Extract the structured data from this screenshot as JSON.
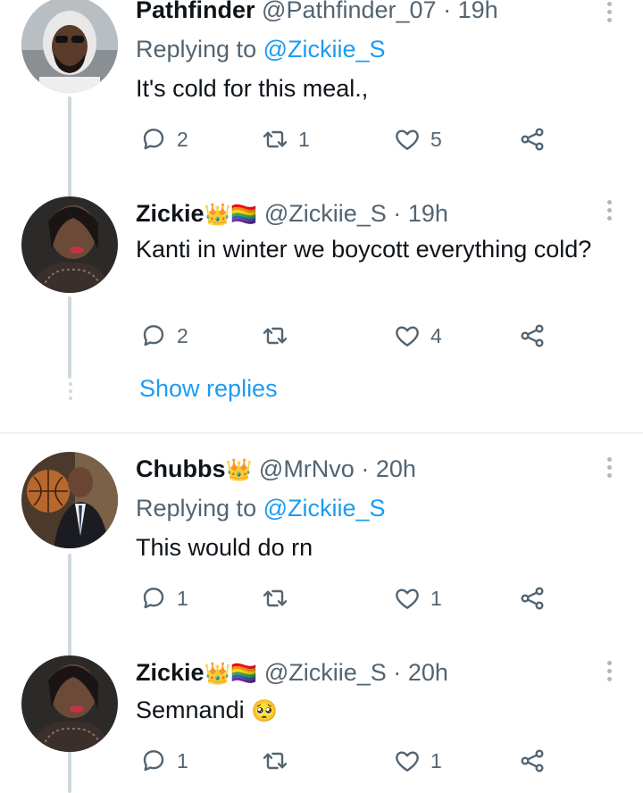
{
  "tweets": [
    {
      "name": "Pathfinder",
      "name_suffix": "",
      "handle": "@Pathfinder_07",
      "dot": "·",
      "time": "19h",
      "replying_prefix": "Replying to ",
      "replying_to": "@Zickiie_S",
      "text": "It's cold for this meal.,",
      "replies": "2",
      "retweets": "1",
      "likes": "5"
    },
    {
      "name": "Zickie",
      "name_suffix": "👑🏳️‍🌈",
      "handle": "@Zickiie_S",
      "dot": "·",
      "time": "19h",
      "text": "Kanti in winter we boycott everything cold?",
      "replies": "2",
      "retweets": "",
      "likes": "4"
    },
    {
      "name": "Chubbs",
      "name_suffix": "👑",
      "handle": "@MrNvo",
      "dot": "·",
      "time": "20h",
      "replying_prefix": "Replying to ",
      "replying_to": "@Zickiie_S",
      "text": "This would do rn",
      "replies": "1",
      "retweets": "",
      "likes": "1"
    },
    {
      "name": "Zickie",
      "name_suffix": "👑🏳️‍🌈",
      "handle": "@Zickiie_S",
      "dot": "·",
      "time": "20h",
      "text": "Semnandi",
      "text_emoji": "🥺",
      "replies": "1",
      "retweets": "",
      "likes": "1"
    }
  ],
  "show_replies": "Show replies",
  "colors": {
    "link": "#1d9bf0",
    "muted": "#536471",
    "text": "#0f1419",
    "thread_line": "#cfd9de"
  },
  "icons": [
    "reply-icon",
    "retweet-icon",
    "like-icon",
    "share-icon",
    "more-icon"
  ]
}
